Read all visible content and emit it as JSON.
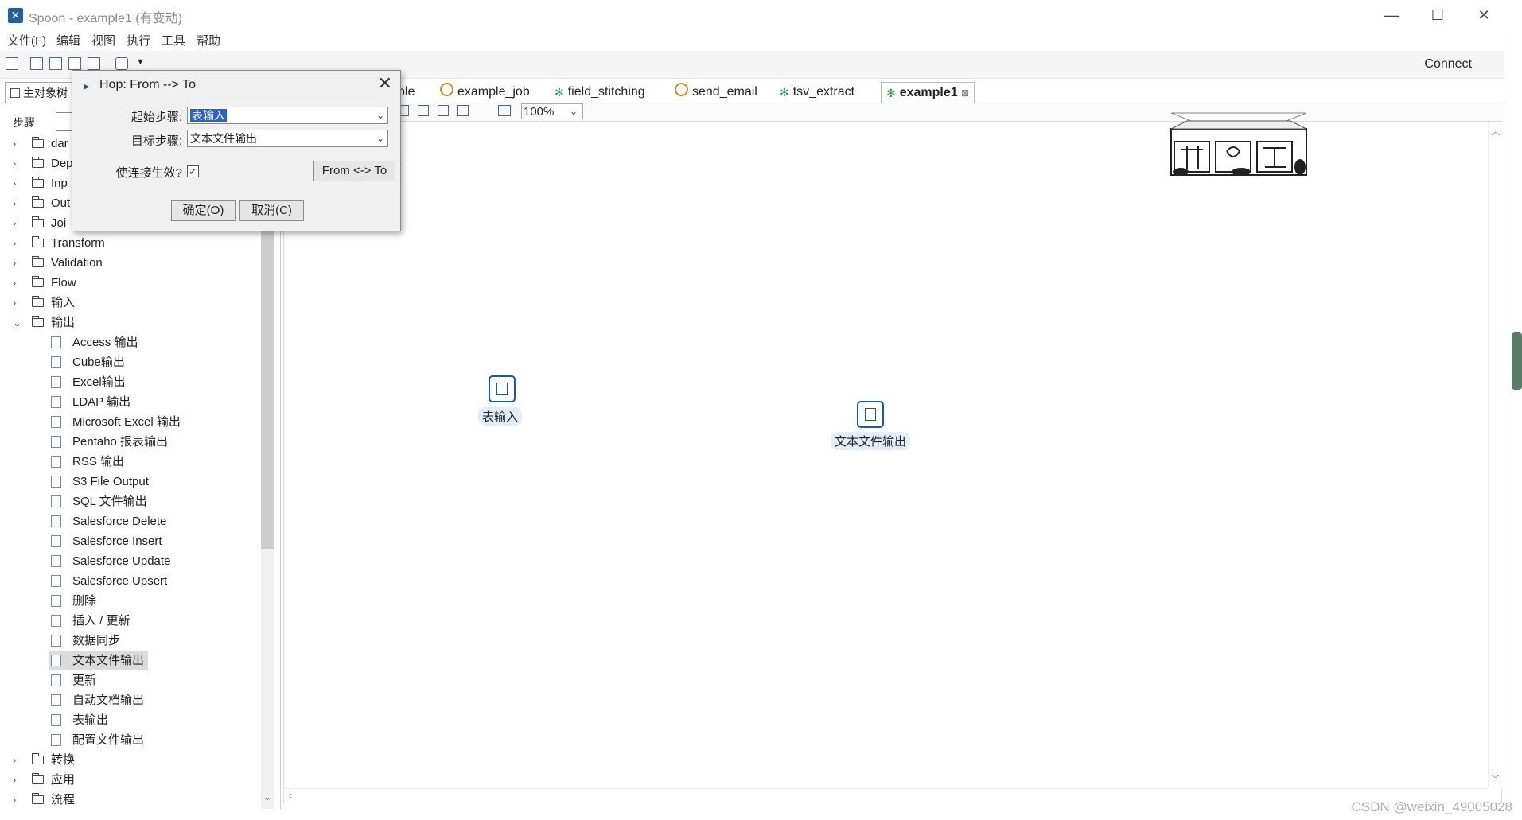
{
  "window": {
    "title": "Spoon - example1 (有变动)",
    "app_icon_glyph": "✕",
    "minimize": "—",
    "maximize": "☐",
    "close": "✕"
  },
  "menu": [
    "文件(F)",
    "编辑",
    "视图",
    "执行",
    "工具",
    "帮助"
  ],
  "toolbar": {
    "connect_label": "Connect"
  },
  "left_panel": {
    "tab_label": "主对象树",
    "steps_label": "步骤",
    "collapsed_folders_top": [
      "dar",
      "Dep",
      "Inp",
      "Out",
      "Joi",
      "Transform",
      "Validation",
      "Flow",
      "输入"
    ],
    "expanded_folder": "输出",
    "output_items": [
      "Access 输出",
      "Cube输出",
      "Excel输出",
      "LDAP 输出",
      "Microsoft Excel 输出",
      "Pentaho 报表输出",
      "RSS 输出",
      "S3 File Output",
      "SQL 文件输出",
      "Salesforce Delete",
      "Salesforce Insert",
      "Salesforce Update",
      "Salesforce Upsert",
      "删除",
      "插入 / 更新",
      "数据同步",
      "文本文件输出",
      "更新",
      "自动文档输出",
      "表输出",
      "配置文件输出"
    ],
    "selected_item": "文本文件输出",
    "collapsed_folders_bottom": [
      "转换",
      "应用",
      "流程"
    ]
  },
  "tabs": [
    {
      "label": "ple",
      "active": false
    },
    {
      "label": "example_job",
      "active": false
    },
    {
      "label": "field_stitching",
      "active": false
    },
    {
      "label": "send_email",
      "active": false
    },
    {
      "label": "tsv_extract",
      "active": false
    },
    {
      "label": "example1",
      "active": true,
      "close_glyph": "⊠"
    }
  ],
  "canvas": {
    "zoom": "100%",
    "steps": [
      {
        "label": "表输入"
      },
      {
        "label": "文本文件输出"
      }
    ]
  },
  "dialog": {
    "title": "Hop: From --> To",
    "from_label": "起始步骤:",
    "from_value": "表输入",
    "to_label": "目标步骤:",
    "to_value": "文本文件输出",
    "enable_label": "使连接生效?",
    "enable_checked": "✓",
    "swap_button": "From <-> To",
    "ok_button": "确定(O)",
    "cancel_button": "取消(C)",
    "close_glyph": "✕"
  },
  "watermark": "CSDN @weixin_49005028"
}
